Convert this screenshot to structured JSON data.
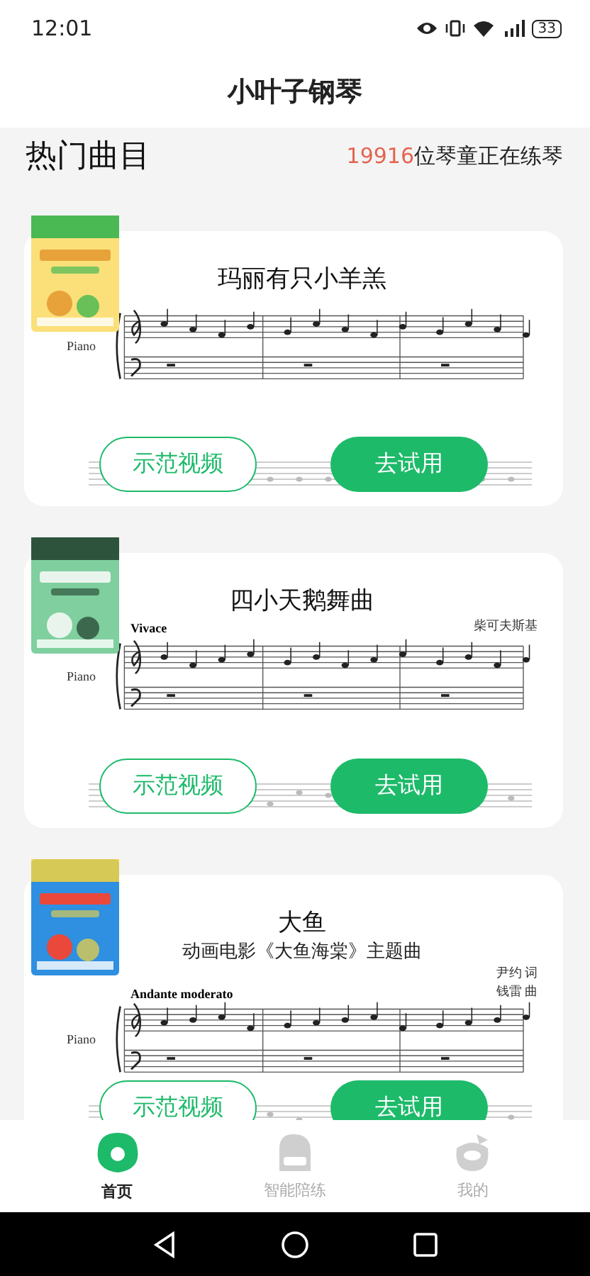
{
  "status_bar": {
    "time": "12:01",
    "battery": "33"
  },
  "app_title": "小叶子钢琴",
  "section": {
    "title": "热门曲目",
    "count": "19916",
    "count_suffix": "位琴童正在练琴"
  },
  "songs": [
    {
      "title": "玛丽有只小羊羔",
      "instrument": "Piano",
      "demo_button": "示范视频",
      "try_button": "去试用"
    },
    {
      "title": "四小天鹅舞曲",
      "composer": "柴可夫斯基",
      "tempo": "Vivace",
      "instrument": "Piano",
      "demo_button": "示范视频",
      "try_button": "去试用"
    },
    {
      "title": "大鱼",
      "subtitle": "动画电影《大鱼海棠》主题曲",
      "credits": [
        "尹约 词",
        "钱雷 曲"
      ],
      "tempo": "Andante moderato",
      "instrument": "Piano",
      "demo_button": "示范视频",
      "try_button": "去试用"
    }
  ],
  "tabs": [
    {
      "label": "首页",
      "selected": true
    },
    {
      "label": "智能陪练",
      "selected": false
    },
    {
      "label": "我的",
      "selected": false
    }
  ]
}
